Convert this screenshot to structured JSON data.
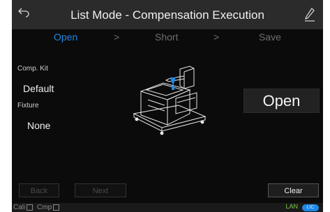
{
  "header": {
    "title": "List Mode - Compensation Execution"
  },
  "steps": [
    {
      "label": "Open"
    },
    {
      "label": "Short"
    },
    {
      "label": "Save"
    }
  ],
  "step_separator": ">",
  "comp_kit": {
    "label": "Comp. Kit",
    "value": "Default"
  },
  "fixture": {
    "label": "Fixture",
    "value": "None"
  },
  "main_action": {
    "label": "Open"
  },
  "nav": {
    "back_label": "Back",
    "next_label": "Next",
    "clear_label": "Clear"
  },
  "status": {
    "cali_label": "Cali",
    "cmp_label": "Cmp",
    "lan_label": "LAN",
    "pill_label": "LIC"
  },
  "colors": {
    "accent": "#1e88e5",
    "background": "#0b0b0b",
    "title_bar": "#2b2b2b"
  },
  "icons": {
    "back": "back-arrow-icon",
    "edit": "pen-icon",
    "device": "fixture-device-icon"
  }
}
